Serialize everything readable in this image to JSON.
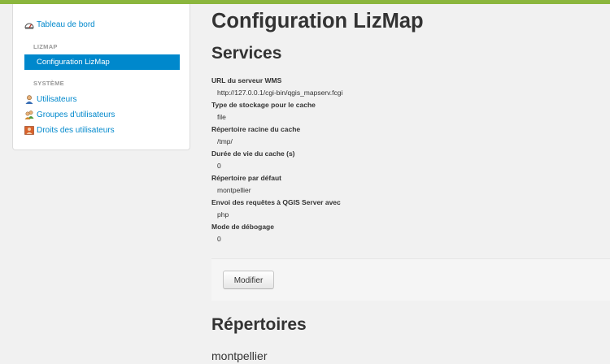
{
  "sidebar": {
    "dashboard_label": "Tableau de bord",
    "section_lizmap": "LIZMAP",
    "config_label": "Configuration LizMap",
    "section_system": "SYSTÈME",
    "users_label": "Utilisateurs",
    "groups_label": "Groupes d'utilisateurs",
    "rights_label": "Droits des utilisateurs"
  },
  "main": {
    "page_title": "Configuration LizMap",
    "services_title": "Services",
    "fields": [
      {
        "label": "URL du serveur WMS",
        "value": "http://127.0.0.1/cgi-bin/qgis_mapserv.fcgi"
      },
      {
        "label": "Type de stockage pour le cache",
        "value": "file"
      },
      {
        "label": "Répertoire racine du cache",
        "value": "/tmp/"
      },
      {
        "label": "Durée de vie du cache (s)",
        "value": "0"
      },
      {
        "label": "Répertoire par défaut",
        "value": "montpellier"
      },
      {
        "label": "Envoi des requêtes à QGIS Server avec",
        "value": "php"
      },
      {
        "label": "Mode de débogage",
        "value": "0"
      }
    ],
    "modify_button": "Modifier",
    "repositories_title": "Répertoires",
    "repository_name": "montpellier"
  },
  "colors": {
    "top_bar": "#8bb63d",
    "link": "#0088cc",
    "active_background": "#0088cc"
  }
}
